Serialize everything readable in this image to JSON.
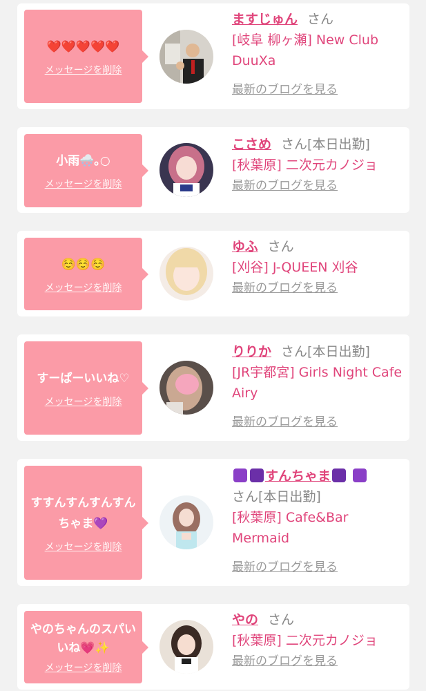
{
  "cards": [
    {
      "message": "❤️❤️❤️❤️❤️",
      "delete_label": "メッセージを削除",
      "name": "ますじゅん",
      "san": "さん",
      "status": "",
      "shop": "[岐阜 柳ヶ瀬] New Club DuuXa",
      "blog": "最新のブログを見る"
    },
    {
      "message": "小雨🌨️｡○",
      "delete_label": "メッセージを削除",
      "name": "こさめ",
      "san": "さん",
      "status": "[本日出勤]",
      "shop": "[秋葉原] 二次元カノジョ",
      "blog": "最新のブログを見る"
    },
    {
      "message": "☺️☺️☺️",
      "delete_label": "メッセージを削除",
      "name": "ゆふ",
      "san": "さん",
      "status": "",
      "shop": "[刈谷] J-QUEEN 刈谷",
      "blog": "最新のブログを見る"
    },
    {
      "message": "すーぱーいいね♡",
      "delete_label": "メッセージを削除",
      "name": "りりか",
      "san": "さん",
      "status": "[本日出勤]",
      "shop": "[JR宇都宮] Girls Night Cafe Airy",
      "blog": "最新のブログを見る"
    },
    {
      "message": "すすんすんすんすんちゃま💜",
      "delete_label": "メッセージを削除",
      "name": "すんちゃま",
      "san": "さん",
      "status": "[本日出勤]",
      "shop": "[秋葉原] Cafe&Bar Mermaid",
      "blog": "最新のブログを見る"
    },
    {
      "message": "やのちゃんのスパいいね💗✨",
      "delete_label": "メッセージを削除",
      "name": "やの",
      "san": "さん",
      "status": "",
      "shop": "[秋葉原] 二次元カノジョ",
      "blog": "最新のブログを見る"
    }
  ],
  "colors": {
    "accent": "#e0457b",
    "bubble": "#fb9ba7",
    "muted": "#888888",
    "emoji_purple": "#8a3fc7"
  }
}
